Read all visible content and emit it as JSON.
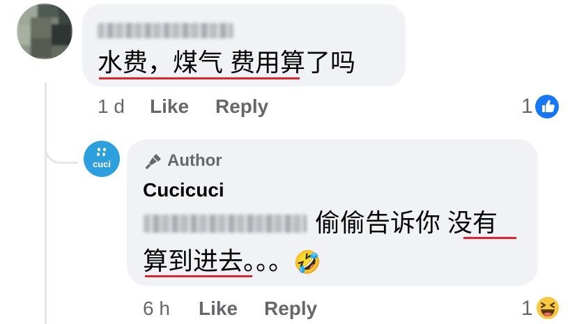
{
  "comment": {
    "author_name_redacted": "Jayden Chee",
    "text_part1": "水费，煤气 费用",
    "text_part2": "算了吗",
    "time": "1 d",
    "like_label": "Like",
    "reply_label": "Reply",
    "reaction_count": "1",
    "reaction_type": "like",
    "reaction_color": "#1877f2"
  },
  "reply": {
    "avatar_text": "cuci",
    "author_badge": "Author",
    "author_name": "Cucicuci",
    "mention_redacted": "Jayden Chee",
    "text_part1": "偷偷告诉你 ",
    "text_part2": "没有",
    "text_part3": "算到进去",
    "text_part4": "。。。",
    "emoji": "🤣",
    "time": "6 h",
    "like_label": "Like",
    "reply_label": "Reply",
    "reaction_count": "1",
    "reaction_type": "haha"
  },
  "colors": {
    "bubble": "#f0f2f5",
    "underline": "#e0242c",
    "meta_text": "#65676b",
    "brand_avatar": "#2d9fdc"
  }
}
